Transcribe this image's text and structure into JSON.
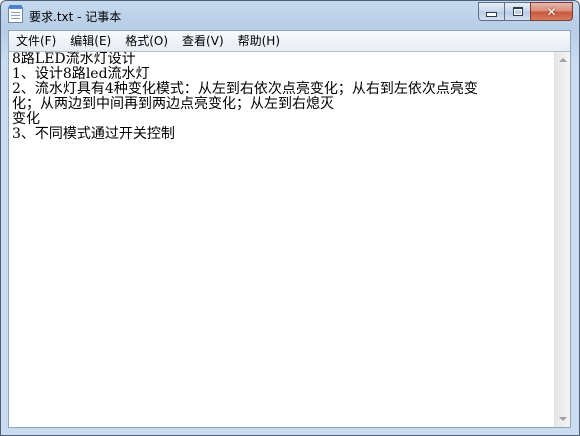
{
  "window": {
    "title": "要求.txt - 记事本",
    "controls": {
      "minimize": "minimize",
      "maximize": "maximize",
      "close": "close"
    },
    "colors": {
      "titlebar": "#c6daee",
      "close_button": "#c5553a",
      "menubar": "#f2f5fa"
    }
  },
  "menu": {
    "items": [
      {
        "label": "文件(F)"
      },
      {
        "label": "编辑(E)"
      },
      {
        "label": "格式(O)"
      },
      {
        "label": "查看(V)"
      },
      {
        "label": "帮助(H)"
      }
    ]
  },
  "document": {
    "lines": [
      "8路LED流水灯设计",
      "1、设计8路led流水灯",
      "2、流水灯具有4种变化模式：从左到右依次点亮变化；从右到左依次点亮变",
      "化；从两边到中间再到两边点亮变化；从左到右熄灭",
      "变化",
      "3、不同模式通过开关控制"
    ]
  },
  "scrollbar": {
    "up_icon": "scroll-up-arrow",
    "down_icon": "scroll-down-arrow"
  }
}
